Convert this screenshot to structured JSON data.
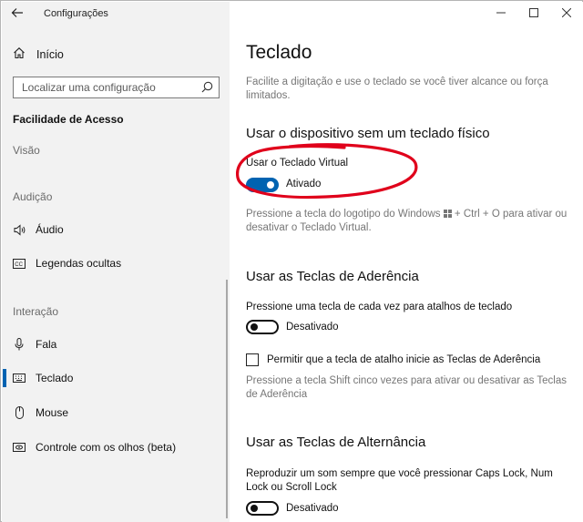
{
  "window": {
    "title": "Configurações",
    "controls": [
      "minimize",
      "maximize",
      "close"
    ]
  },
  "sidebar": {
    "home_label": "Início",
    "search_placeholder": "Localizar uma configuração",
    "section_title": "Facilidade de Acesso",
    "groups": [
      {
        "label": "Visão"
      },
      {
        "label": "Audição"
      },
      {
        "label": "Interação"
      }
    ],
    "items": [
      {
        "label": "Áudio",
        "icon": "speaker-icon"
      },
      {
        "label": "Legendas ocultas",
        "icon": "closed-captions-icon"
      },
      {
        "label": "Fala",
        "icon": "microphone-icon"
      },
      {
        "label": "Teclado",
        "icon": "keyboard-icon",
        "active": true
      },
      {
        "label": "Mouse",
        "icon": "mouse-icon"
      },
      {
        "label": "Controle com os olhos (beta)",
        "icon": "eye-control-icon"
      }
    ]
  },
  "main": {
    "title": "Teclado",
    "intro": "Facilite a digitação e use o teclado se você tiver alcance ou força limitados.",
    "virtual_keyboard": {
      "heading": "Usar o dispositivo sem um teclado físico",
      "label": "Usar o Teclado Virtual",
      "state": "Ativado",
      "on": true,
      "hint_before": "Pressione a tecla do logotipo do Windows",
      "hint_after": "+ Ctrl + O para ativar ou desativar o Teclado Virtual."
    },
    "sticky_keys": {
      "heading": "Usar as Teclas de Aderência",
      "label": "Pressione uma tecla de cada vez para atalhos de teclado",
      "state": "Desativado",
      "on": false,
      "shortcut_checkbox_label": "Permitir que a tecla de atalho inicie as Teclas de Aderência",
      "shortcut_checked": false,
      "shortcut_hint": "Pressione a tecla Shift cinco vezes para ativar ou desativar as Teclas de Aderência"
    },
    "toggle_keys": {
      "heading": "Usar as Teclas de Alternância",
      "label": "Reproduzir um som sempre que você pressionar Caps Lock, Num Lock ou Scroll Lock",
      "state": "Desativado",
      "on": false
    }
  },
  "colors": {
    "accent": "#0063b1",
    "annotation": "#e0001b",
    "sidebar_bg": "#f2f2f2",
    "muted_text": "#767676"
  }
}
